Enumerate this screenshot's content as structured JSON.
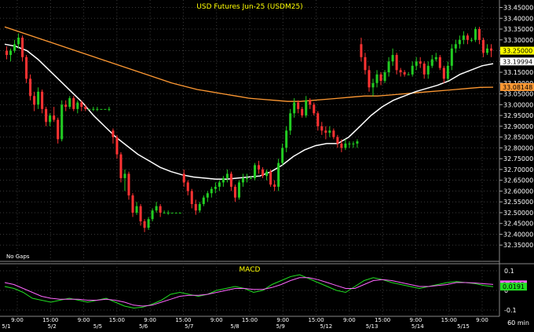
{
  "chart_data": [
    {
      "type": "candlestick",
      "title": "USD Futures Jun-25 (USDM25)",
      "note": "No Gaps",
      "ylim": [
        32.3,
        33.47
      ],
      "y_ticks": [
        "33.45000",
        "33.40000",
        "33.35000",
        "33.30000",
        "33.25000",
        "33.20000",
        "33.15000",
        "33.10000",
        "33.05000",
        "33.00000",
        "32.95000",
        "32.90000",
        "32.85000",
        "32.80000",
        "32.75000",
        "32.70000",
        "32.65000",
        "32.60000",
        "32.55000",
        "32.50000",
        "32.45000",
        "32.40000",
        "32.35000"
      ],
      "x_ticks_top": [
        "9:00",
        "15:00",
        "9:00",
        "15:00",
        "9:00",
        "15:00",
        "9:00",
        "15:00",
        "9:00",
        "15:00",
        "9:00",
        "15:00",
        "9:00",
        "15:00",
        "9:00"
      ],
      "x_ticks_bottom": [
        "5/1",
        "5/2",
        "5/5",
        "5/6",
        "5/7",
        "5/8",
        "5/9",
        "5/12",
        "5/13",
        "5/14",
        "5/15"
      ],
      "last_price_labels": [
        {
          "value": "33.25000",
          "color": "#ffff00"
        },
        {
          "value": "33.19994",
          "color": "#ffffff"
        },
        {
          "value": "33.08148",
          "color": "#ff9933"
        }
      ],
      "colors": {
        "up": "#22cc22",
        "down": "#ff3333",
        "ma_fast": "#ffffff",
        "ma_slow": "#ff9933",
        "grid": "#3a3a3a"
      },
      "candles": [
        [
          33.25,
          33.27,
          33.21,
          33.23
        ],
        [
          33.23,
          33.26,
          33.2,
          33.25
        ],
        [
          33.25,
          33.3,
          33.24,
          33.28
        ],
        [
          33.28,
          33.33,
          33.26,
          33.31
        ],
        [
          33.31,
          33.32,
          33.2,
          33.22
        ],
        [
          33.22,
          33.23,
          33.1,
          33.12
        ],
        [
          33.12,
          33.14,
          33.02,
          33.04
        ],
        [
          33.04,
          33.06,
          32.97,
          33
        ],
        [
          33,
          33.08,
          32.98,
          33.06
        ],
        [
          33.06,
          33.07,
          32.96,
          32.98
        ],
        [
          32.98,
          32.99,
          32.9,
          32.92
        ],
        [
          32.92,
          32.96,
          32.9,
          32.95
        ],
        [
          32.95,
          32.99,
          32.92,
          32.93
        ],
        [
          32.93,
          32.94,
          32.82,
          32.84
        ],
        [
          32.84,
          33.02,
          32.83,
          33
        ],
        [
          33,
          33.02,
          32.97,
          32.99
        ],
        [
          32.99,
          33.04,
          32.98,
          33.03
        ],
        [
          33.03,
          33.04,
          32.97,
          32.98
        ],
        [
          32.98,
          33.02,
          32.96,
          33.01
        ],
        [
          33.01,
          33.02,
          32.97,
          32.99
        ],
        [
          32.99,
          33,
          32.97,
          32.98
        ],
        [
          32.98,
          32.98,
          32.98,
          32.98
        ],
        [
          32.98,
          32.99,
          32.97,
          32.98
        ],
        [
          32.98,
          32.99,
          32.97,
          32.98
        ],
        [
          32.98,
          32.98,
          32.98,
          32.98
        ],
        [
          32.98,
          32.98,
          32.98,
          32.98
        ],
        [
          32.98,
          32.99,
          32.97,
          32.98
        ],
        [
          32.88,
          32.89,
          32.82,
          32.85
        ],
        [
          32.85,
          32.86,
          32.75,
          32.77
        ],
        [
          32.77,
          32.78,
          32.64,
          32.66
        ],
        [
          32.66,
          32.7,
          32.6,
          32.68
        ],
        [
          32.68,
          32.69,
          32.56,
          32.58
        ],
        [
          32.58,
          32.59,
          32.48,
          32.5
        ],
        [
          32.5,
          32.55,
          32.49,
          32.53
        ],
        [
          32.53,
          32.54,
          32.44,
          32.46
        ],
        [
          32.46,
          32.47,
          32.41,
          32.43
        ],
        [
          32.43,
          32.48,
          32.42,
          32.47
        ],
        [
          32.47,
          32.52,
          32.46,
          32.51
        ],
        [
          32.51,
          32.55,
          32.5,
          32.53
        ],
        [
          32.53,
          32.54,
          32.48,
          32.5
        ],
        [
          32.5,
          32.51,
          32.5,
          32.5
        ],
        [
          32.5,
          32.51,
          32.49,
          32.5
        ],
        [
          32.5,
          32.5,
          32.5,
          32.5
        ],
        [
          32.5,
          32.5,
          32.5,
          32.5
        ],
        [
          32.5,
          32.5,
          32.5,
          32.5
        ],
        [
          32.68,
          32.7,
          32.62,
          32.64
        ],
        [
          32.64,
          32.65,
          32.58,
          32.6
        ],
        [
          32.6,
          32.61,
          32.52,
          32.54
        ],
        [
          32.54,
          32.56,
          32.49,
          32.51
        ],
        [
          32.51,
          32.55,
          32.5,
          32.54
        ],
        [
          32.54,
          32.58,
          32.53,
          32.57
        ],
        [
          32.57,
          32.6,
          32.55,
          32.59
        ],
        [
          32.59,
          32.62,
          32.57,
          32.61
        ],
        [
          32.61,
          32.64,
          32.59,
          32.62
        ],
        [
          32.62,
          32.65,
          32.6,
          32.64
        ],
        [
          32.64,
          32.67,
          32.62,
          32.66
        ],
        [
          32.66,
          32.7,
          32.64,
          32.68
        ],
        [
          32.68,
          32.69,
          32.6,
          32.62
        ],
        [
          32.62,
          32.63,
          32.55,
          32.57
        ],
        [
          32.57,
          32.65,
          32.56,
          32.64
        ],
        [
          32.64,
          32.68,
          32.62,
          32.66
        ],
        [
          32.66,
          32.68,
          32.64,
          32.66
        ],
        [
          32.66,
          32.67,
          32.66,
          32.66
        ],
        [
          32.66,
          32.73,
          32.65,
          32.72
        ],
        [
          32.72,
          32.74,
          32.68,
          32.7
        ],
        [
          32.7,
          32.71,
          32.66,
          32.67
        ],
        [
          32.67,
          32.7,
          32.65,
          32.69
        ],
        [
          32.69,
          32.7,
          32.62,
          32.63
        ],
        [
          32.63,
          32.65,
          32.6,
          32.62
        ],
        [
          32.62,
          32.75,
          32.6,
          32.73
        ],
        [
          32.73,
          32.82,
          32.72,
          32.8
        ],
        [
          32.8,
          32.9,
          32.78,
          32.88
        ],
        [
          32.88,
          32.98,
          32.86,
          32.96
        ],
        [
          32.96,
          33.03,
          32.94,
          33.01
        ],
        [
          33.01,
          33.02,
          32.96,
          32.98
        ],
        [
          32.98,
          32.99,
          32.94,
          32.95
        ],
        [
          32.95,
          33.04,
          32.94,
          33.02
        ],
        [
          33.02,
          33.03,
          32.98,
          33
        ],
        [
          33,
          33.01,
          32.95,
          32.96
        ],
        [
          32.96,
          32.97,
          32.88,
          32.9
        ],
        [
          32.9,
          32.92,
          32.86,
          32.88
        ],
        [
          32.88,
          32.9,
          32.84,
          32.87
        ],
        [
          32.87,
          32.9,
          32.85,
          32.88
        ],
        [
          32.88,
          32.89,
          32.84,
          32.85
        ],
        [
          32.85,
          32.86,
          32.8,
          32.82
        ],
        [
          32.82,
          32.84,
          32.78,
          32.8
        ],
        [
          32.8,
          32.84,
          32.79,
          32.82
        ],
        [
          32.82,
          32.83,
          32.8,
          32.82
        ],
        [
          32.82,
          32.83,
          32.8,
          32.82
        ],
        [
          32.82,
          32.84,
          32.8,
          32.83
        ],
        [
          33.28,
          33.31,
          33.2,
          33.22
        ],
        [
          33.22,
          33.24,
          33.14,
          33.16
        ],
        [
          33.16,
          33.18,
          33.06,
          33.08
        ],
        [
          33.08,
          33.12,
          33.04,
          33.1
        ],
        [
          33.1,
          33.16,
          33.08,
          33.14
        ],
        [
          33.14,
          33.15,
          33.09,
          33.11
        ],
        [
          33.11,
          33.16,
          33.1,
          33.15
        ],
        [
          33.15,
          33.22,
          33.13,
          33.2
        ],
        [
          33.2,
          33.26,
          33.18,
          33.23
        ],
        [
          33.23,
          33.24,
          33.14,
          33.16
        ],
        [
          33.16,
          33.17,
          33.13,
          33.15
        ],
        [
          33.15,
          33.16,
          33.13,
          33.14
        ],
        [
          33.14,
          33.15,
          33.14,
          33.14
        ],
        [
          33.14,
          33.2,
          33.13,
          33.18
        ],
        [
          33.18,
          33.22,
          33.16,
          33.2
        ],
        [
          33.2,
          33.22,
          33.17,
          33.19
        ],
        [
          33.19,
          33.2,
          33.12,
          33.14
        ],
        [
          33.14,
          33.2,
          33.12,
          33.18
        ],
        [
          33.18,
          33.23,
          33.17,
          33.21
        ],
        [
          33.21,
          33.24,
          33.2,
          33.22
        ],
        [
          33.22,
          33.23,
          33.16,
          33.17
        ],
        [
          33.17,
          33.18,
          33.1,
          33.12
        ],
        [
          33.12,
          33.2,
          33.11,
          33.18
        ],
        [
          33.18,
          33.28,
          33.16,
          33.26
        ],
        [
          33.26,
          33.3,
          33.24,
          33.28
        ],
        [
          33.28,
          33.32,
          33.26,
          33.3
        ],
        [
          33.3,
          33.34,
          33.28,
          33.32
        ],
        [
          33.32,
          33.33,
          33.28,
          33.3
        ],
        [
          33.3,
          33.31,
          33.29,
          33.3
        ],
        [
          33.3,
          33.36,
          33.29,
          33.35
        ],
        [
          33.35,
          33.36,
          33.28,
          33.3
        ],
        [
          33.3,
          33.31,
          33.22,
          33.24
        ],
        [
          33.24,
          33.28,
          33.23,
          33.26
        ],
        [
          33.26,
          33.28,
          33.22,
          33.25
        ]
      ],
      "ma_fast": [
        33.28,
        33.27,
        33.25,
        33.21,
        33.16,
        33.11,
        33.06,
        33.01,
        32.95,
        32.9,
        32.85,
        32.81,
        32.77,
        32.74,
        32.71,
        32.69,
        32.675,
        32.665,
        32.66,
        32.655,
        32.655,
        32.66,
        32.665,
        32.67,
        32.69,
        32.72,
        32.76,
        32.79,
        32.81,
        32.82,
        32.82,
        32.85,
        32.9,
        32.95,
        32.99,
        33.02,
        33.04,
        33.06,
        33.075,
        33.09,
        33.11,
        33.14,
        33.16,
        33.18,
        33.19
      ],
      "ma_slow": [
        33.36,
        33.34,
        33.32,
        33.3,
        33.28,
        33.26,
        33.24,
        33.22,
        33.2,
        33.18,
        33.16,
        33.14,
        33.12,
        33.1,
        33.085,
        33.07,
        33.06,
        33.05,
        33.04,
        33.03,
        33.025,
        33.02,
        33.015,
        33.015,
        33.02,
        33.025,
        33.03,
        33.035,
        33.04,
        33.04,
        33.045,
        33.05,
        33.055,
        33.06,
        33.065,
        33.07,
        33.075,
        33.08,
        33.081
      ]
    },
    {
      "type": "line",
      "title": "MACD",
      "ylim": [
        -0.12,
        0.12
      ],
      "y_ticks": [
        "0.1",
        "0",
        "-0.1"
      ],
      "interval_label": "60 min",
      "last_value_labels": [
        {
          "value": "0.0305",
          "color": "#ff66ff"
        },
        {
          "value": "0.0191",
          "color": "#22dd22"
        }
      ],
      "series": [
        {
          "color": "#22dd22",
          "values": [
            0.02,
            0.01,
            -0.01,
            -0.04,
            -0.05,
            -0.06,
            -0.05,
            -0.04,
            -0.05,
            -0.06,
            -0.05,
            -0.04,
            -0.06,
            -0.08,
            -0.09,
            -0.085,
            -0.07,
            -0.05,
            -0.02,
            -0.01,
            -0.02,
            -0.03,
            -0.02,
            0,
            0.01,
            0.02,
            0.01,
            -0.01,
            0,
            0.03,
            0.05,
            0.07,
            0.08,
            0.06,
            0.04,
            0.02,
            0,
            -0.01,
            0.02,
            0.05,
            0.065,
            0.055,
            0.04,
            0.03,
            0.02,
            0.01,
            0.02,
            0.03,
            0.04,
            0.045,
            0.04,
            0.035,
            0.025,
            0.019
          ]
        },
        {
          "color": "#ff66ff",
          "values": [
            0.04,
            0.03,
            0.01,
            -0.01,
            -0.03,
            -0.04,
            -0.045,
            -0.045,
            -0.045,
            -0.05,
            -0.05,
            -0.045,
            -0.05,
            -0.06,
            -0.075,
            -0.08,
            -0.075,
            -0.06,
            -0.045,
            -0.03,
            -0.025,
            -0.025,
            -0.02,
            -0.01,
            0,
            0.01,
            0.01,
            0.005,
            0.005,
            0.015,
            0.03,
            0.05,
            0.065,
            0.065,
            0.055,
            0.04,
            0.025,
            0.01,
            0.01,
            0.03,
            0.05,
            0.055,
            0.05,
            0.04,
            0.03,
            0.02,
            0.02,
            0.025,
            0.03,
            0.04,
            0.04,
            0.038,
            0.034,
            0.0305
          ]
        }
      ]
    }
  ]
}
